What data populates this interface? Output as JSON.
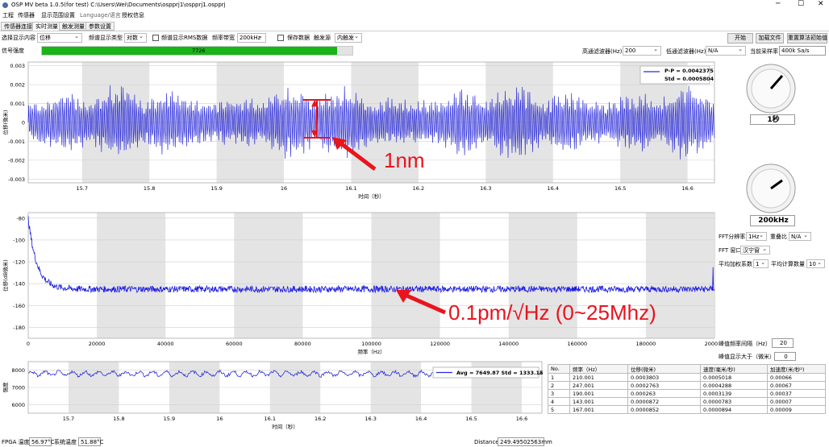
{
  "window": {
    "title": "OSP MV beta 1.0.5(for test)  C:\\Users\\Wei\\Documents\\ospprj1\\ospprj1.ospprj"
  },
  "menu": [
    "工程",
    "传感器",
    "显示范围设置",
    "Language/语言",
    "授权信息"
  ],
  "tabs": [
    "传感器连接",
    "实时测量",
    "触发测量",
    "参数设置"
  ],
  "toolbar": {
    "display_label": "选择显示内容",
    "display_value": "位移",
    "spectrum_type_label": "频谱显示类型",
    "spectrum_type_value": "对数",
    "rms_label": "频谱显示RMS数据",
    "bandwidth_label": "频率带宽",
    "bandwidth_value": "200kHz",
    "save_label": "保存数据",
    "trigger_label": "触发源",
    "trigger_value": "内触发",
    "start_btn": "开始",
    "load_btn": "加载文件",
    "reset_btn": "重置算法初始值"
  },
  "signal": {
    "label": "信号强度",
    "value": "7726",
    "level": 0.95
  },
  "filters": {
    "hp_label": "高通滤波器(Hz)",
    "hp_value": "200",
    "lp_label": "低通滤波器(Hz)",
    "lp_value": "N/A",
    "rate_label": "当前采样率",
    "rate_value": "400k Sa/s"
  },
  "chart_data": [
    {
      "type": "line",
      "ylabel": "位移(微米)",
      "xlabel": "时间（秒）",
      "xlim": [
        15.62,
        16.64
      ],
      "ylim": [
        -0.0032,
        0.0032
      ],
      "xticks": [
        "15.7",
        "15.8",
        "15.9",
        "16",
        "16.1",
        "16.2",
        "16.3",
        "16.4",
        "16.5",
        "16.6"
      ],
      "yticks": [
        "0.003",
        "0.002",
        "0.001",
        "0",
        "-0.001",
        "-0.002",
        "-0.003"
      ],
      "legend": [
        "P-P = 0.0042375",
        "Std = 0.0005804"
      ],
      "series": {
        "color": "#2a2ad8",
        "amplitude": 0.0021
      }
    },
    {
      "type": "line",
      "ylabel": "位移(dB微米)",
      "xlabel": "频率（Hz）",
      "xlim": [
        0,
        200000
      ],
      "ylim": [
        -190,
        -75
      ],
      "xticks": [
        "0",
        "20000",
        "40000",
        "60000",
        "80000",
        "100000",
        "120000",
        "140000",
        "160000",
        "180000",
        "200000"
      ],
      "yticks": [
        "-80",
        "-100",
        "-120",
        "-140",
        "-160",
        "-180"
      ],
      "series": {
        "color": "#1a1ae0",
        "floor": -145,
        "start": -80
      }
    },
    {
      "type": "line",
      "ylabel": "强度",
      "xlabel": "时间（秒）",
      "xlim": [
        15.62,
        16.64
      ],
      "ylim": [
        5500,
        8500
      ],
      "xticks": [
        "15.7",
        "15.8",
        "15.9",
        "16",
        "16.1",
        "16.2",
        "16.3",
        "16.4",
        "16.5",
        "16.6"
      ],
      "yticks": [
        "8000",
        "7000",
        "6000"
      ],
      "legend": [
        "Avg = 7649.87  Std = 1333.15"
      ],
      "series": {
        "color": "#2a2ad8",
        "mean": 7800
      }
    }
  ],
  "knob1": {
    "label": "1秒"
  },
  "knob2": {
    "label": "200kHz"
  },
  "fft": {
    "res_label": "FFT分辨率",
    "res_value": "1Hz",
    "overlap_label": "重叠比",
    "overlap_value": "N/A",
    "window_label": "FFT 窗口",
    "window_value": "汉宁窗",
    "avg_w_label": "平均加权系数",
    "avg_w_value": "1",
    "avg_n_label": "平均计算数量",
    "avg_n_value": "10"
  },
  "peak_settings": {
    "interval_label": "峰值频率间隔（Hz）",
    "interval_value": "20",
    "min_label": "峰值显示大于（微米）",
    "min_value": "0"
  },
  "annotations": {
    "a1": "1nm",
    "a2": "0.1pm/√Hz (0~25Mhz)"
  },
  "table": {
    "headers": [
      "No.",
      "频率（Hz）",
      "位移(微米)",
      "速度(毫米/秒)",
      "加速度(米/秒²)"
    ],
    "rows": [
      [
        "1",
        "210.001",
        "0.0003803",
        "0.0005018",
        "0.00066"
      ],
      [
        "2",
        "247.001",
        "0.0002763",
        "0.0004288",
        "0.00067"
      ],
      [
        "3",
        "190.001",
        "0.000263",
        "0.0003139",
        "0.00037"
      ],
      [
        "4",
        "143.001",
        "0.0000872",
        "0.0000783",
        "0.00007"
      ],
      [
        "5",
        "167.001",
        "0.0000852",
        "0.0000894",
        "0.00009"
      ]
    ]
  },
  "status": {
    "fpga_label": "FPGA 温度",
    "fpga_value": "56.97°C",
    "sys_label": "系统温度",
    "sys_value": "51.88°C",
    "distance_label": "Distance:",
    "distance_value": "249.49502563mm"
  },
  "colors": {
    "accent": "#18b418",
    "annotation": "#e8141e",
    "trace": "#2a2ad8"
  }
}
